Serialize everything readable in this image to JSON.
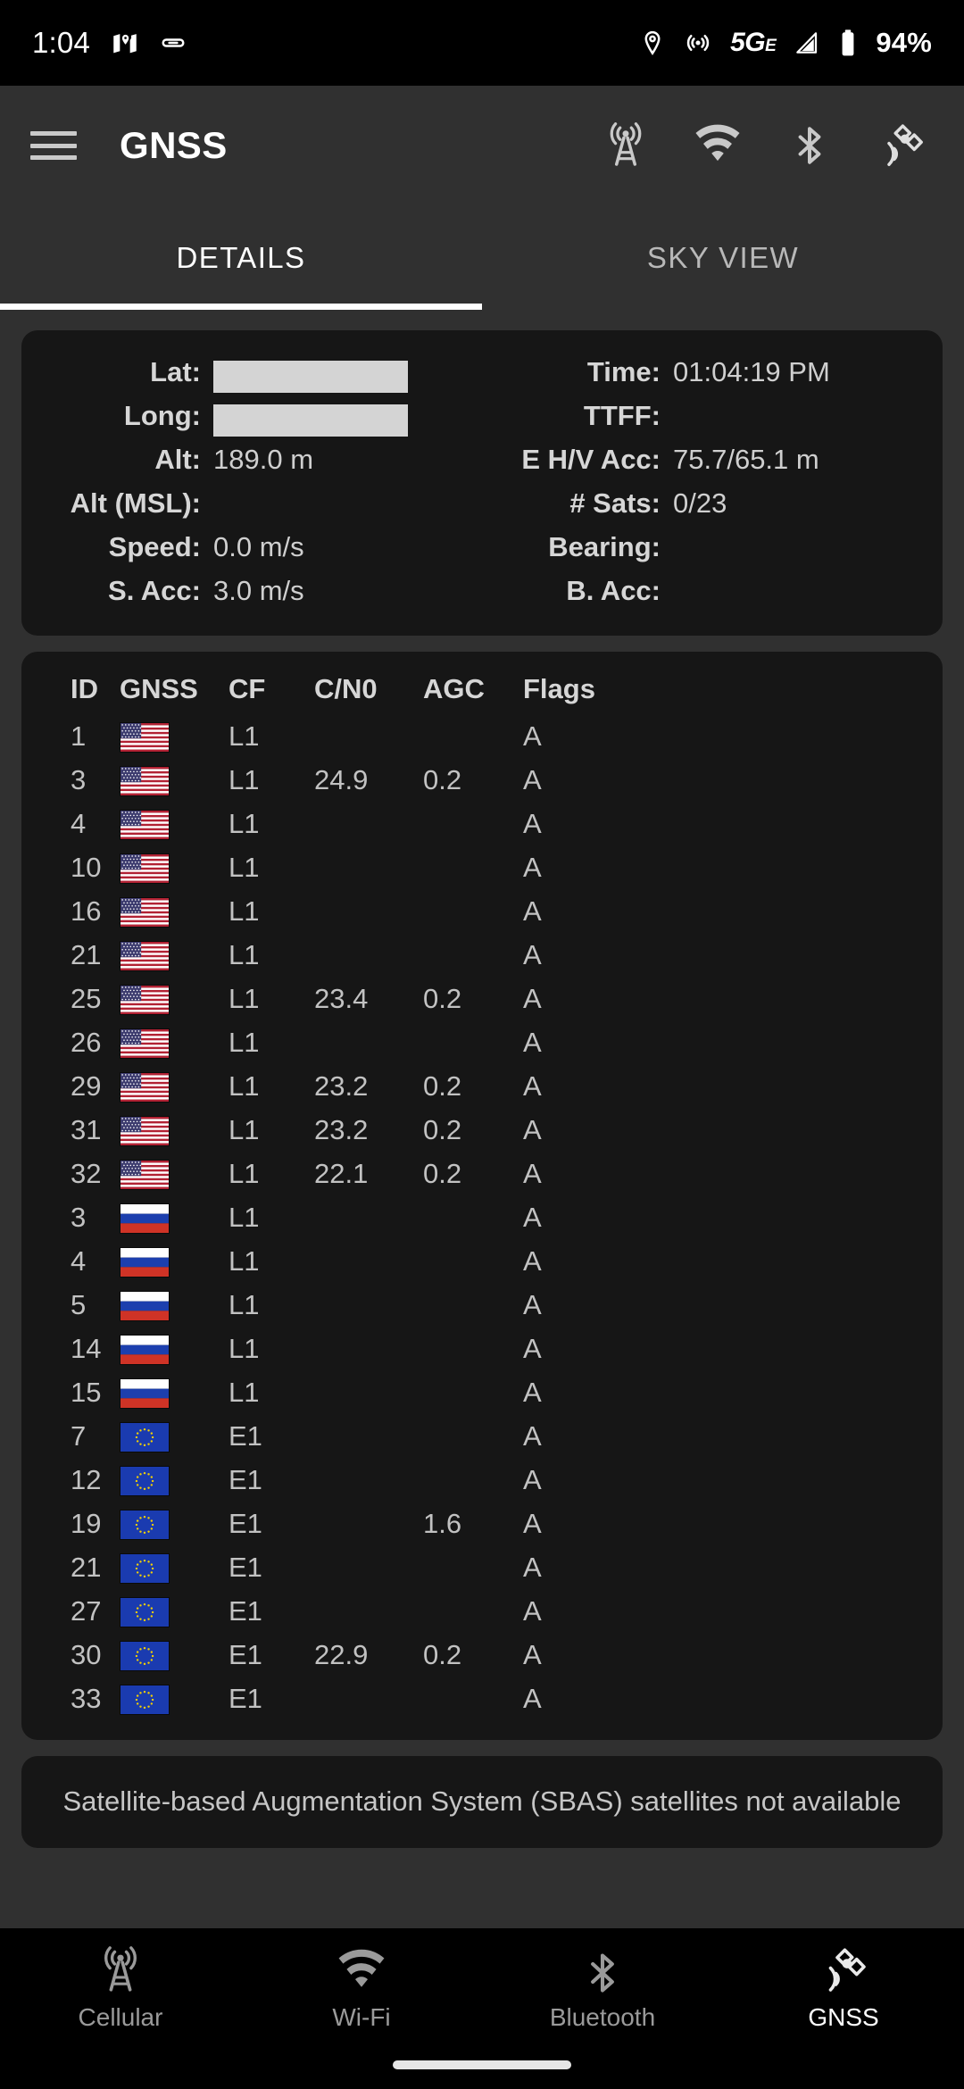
{
  "status_bar": {
    "time": "1:04",
    "left_icons": [
      "maps-icon",
      "link-icon"
    ],
    "right_icons": [
      "location-pin-icon",
      "hotspot-icon"
    ],
    "network_label": "5G",
    "network_sublabel": "E",
    "signal_icon": "cellular-signal-icon",
    "battery_icon": "battery-icon",
    "battery_label": "94%"
  },
  "app_bar": {
    "menu_icon": "hamburger-menu-icon",
    "title": "GNSS",
    "actions": [
      {
        "icon": "cellular-tower-icon",
        "name": "cellular"
      },
      {
        "icon": "wifi-icon",
        "name": "wifi"
      },
      {
        "icon": "bluetooth-icon",
        "name": "bluetooth"
      },
      {
        "icon": "satellite-icon",
        "name": "gnss"
      }
    ]
  },
  "tabs": {
    "items": [
      {
        "label": "DETAILS",
        "active": true
      },
      {
        "label": "SKY VIEW",
        "active": false
      }
    ]
  },
  "info": {
    "lat_label": "Lat:",
    "lat_value": "",
    "lat_redacted": true,
    "time_label": "Time:",
    "time_value": "01:04:19 PM",
    "long_label": "Long:",
    "long_value": "",
    "long_redacted": true,
    "ttff_label": "TTFF:",
    "ttff_value": "",
    "alt_label": "Alt:",
    "alt_value": "189.0 m",
    "ehv_label": "E H/V Acc:",
    "ehv_value": "75.7/65.1 m",
    "altmsl_label": "Alt (MSL):",
    "altmsl_value": "",
    "sats_label": "# Sats:",
    "sats_value": "0/23",
    "speed_label": "Speed:",
    "speed_value": "0.0 m/s",
    "bearing_label": "Bearing:",
    "bearing_value": "",
    "sacc_label": "S. Acc:",
    "sacc_value": "3.0 m/s",
    "bacc_label": "B. Acc:",
    "bacc_value": ""
  },
  "sat_table": {
    "columns": [
      "ID",
      "GNSS",
      "CF",
      "C/N0",
      "AGC",
      "Flags"
    ],
    "rows": [
      {
        "id": "1",
        "flag": "us",
        "cf": "L1",
        "cno": "",
        "agc": "",
        "flags": "A"
      },
      {
        "id": "3",
        "flag": "us",
        "cf": "L1",
        "cno": "24.9",
        "agc": "0.2",
        "flags": "A"
      },
      {
        "id": "4",
        "flag": "us",
        "cf": "L1",
        "cno": "",
        "agc": "",
        "flags": "A"
      },
      {
        "id": "10",
        "flag": "us",
        "cf": "L1",
        "cno": "",
        "agc": "",
        "flags": "A"
      },
      {
        "id": "16",
        "flag": "us",
        "cf": "L1",
        "cno": "",
        "agc": "",
        "flags": "A"
      },
      {
        "id": "21",
        "flag": "us",
        "cf": "L1",
        "cno": "",
        "agc": "",
        "flags": "A"
      },
      {
        "id": "25",
        "flag": "us",
        "cf": "L1",
        "cno": "23.4",
        "agc": "0.2",
        "flags": "A"
      },
      {
        "id": "26",
        "flag": "us",
        "cf": "L1",
        "cno": "",
        "agc": "",
        "flags": "A"
      },
      {
        "id": "29",
        "flag": "us",
        "cf": "L1",
        "cno": "23.2",
        "agc": "0.2",
        "flags": "A"
      },
      {
        "id": "31",
        "flag": "us",
        "cf": "L1",
        "cno": "23.2",
        "agc": "0.2",
        "flags": "A"
      },
      {
        "id": "32",
        "flag": "us",
        "cf": "L1",
        "cno": "22.1",
        "agc": "0.2",
        "flags": "A"
      },
      {
        "id": "3",
        "flag": "ru",
        "cf": "L1",
        "cno": "",
        "agc": "",
        "flags": "A"
      },
      {
        "id": "4",
        "flag": "ru",
        "cf": "L1",
        "cno": "",
        "agc": "",
        "flags": "A"
      },
      {
        "id": "5",
        "flag": "ru",
        "cf": "L1",
        "cno": "",
        "agc": "",
        "flags": "A"
      },
      {
        "id": "14",
        "flag": "ru",
        "cf": "L1",
        "cno": "",
        "agc": "",
        "flags": "A"
      },
      {
        "id": "15",
        "flag": "ru",
        "cf": "L1",
        "cno": "",
        "agc": "",
        "flags": "A"
      },
      {
        "id": "7",
        "flag": "eu",
        "cf": "E1",
        "cno": "",
        "agc": "",
        "flags": "A"
      },
      {
        "id": "12",
        "flag": "eu",
        "cf": "E1",
        "cno": "",
        "agc": "",
        "flags": "A"
      },
      {
        "id": "19",
        "flag": "eu",
        "cf": "E1",
        "cno": "",
        "agc": "1.6",
        "flags": "A"
      },
      {
        "id": "21",
        "flag": "eu",
        "cf": "E1",
        "cno": "",
        "agc": "",
        "flags": "A"
      },
      {
        "id": "27",
        "flag": "eu",
        "cf": "E1",
        "cno": "",
        "agc": "",
        "flags": "A"
      },
      {
        "id": "30",
        "flag": "eu",
        "cf": "E1",
        "cno": "22.9",
        "agc": "0.2",
        "flags": "A"
      },
      {
        "id": "33",
        "flag": "eu",
        "cf": "E1",
        "cno": "",
        "agc": "",
        "flags": "A"
      }
    ]
  },
  "sbas": {
    "message": "Satellite-based Augmentation System (SBAS) satellites not available"
  },
  "bottom_nav": {
    "items": [
      {
        "label": "Cellular",
        "icon": "cellular-tower-icon",
        "active": false
      },
      {
        "label": "Wi-Fi",
        "icon": "wifi-icon",
        "active": false
      },
      {
        "label": "Bluetooth",
        "icon": "bluetooth-icon",
        "active": false
      },
      {
        "label": "GNSS",
        "icon": "satellite-icon",
        "active": true
      }
    ]
  },
  "colors": {
    "background": "#303030",
    "card": "#161616",
    "accent": "#ffffff",
    "text_primary": "#d6d6d6",
    "text_secondary": "#c2c2c2",
    "nav_inactive": "#9a9a9a"
  }
}
